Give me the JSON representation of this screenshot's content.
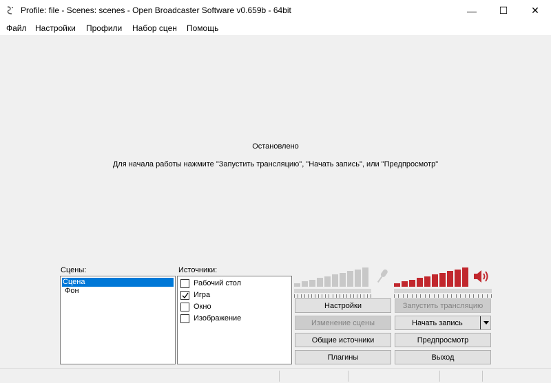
{
  "window": {
    "title": "Profile: file - Scenes: scenes - Open Broadcaster Software v0.659b - 64bit",
    "minimize_glyph": "—",
    "maximize_glyph": "☐",
    "close_glyph": "✕"
  },
  "menu": {
    "items": [
      "Файл",
      "Настройки",
      "Профили",
      "Набор сцен",
      "Помощь"
    ]
  },
  "preview": {
    "status": "Остановлено",
    "hint": "Для начала работы нажмите \"Запустить трансляцию\", \"Начать запись\", или \"Предпросмотр\""
  },
  "scenes": {
    "label": "Сцены:",
    "items": [
      {
        "label": "Сцена",
        "selected": true
      },
      {
        "label": "Фон",
        "selected": false
      }
    ]
  },
  "sources": {
    "label": "Источники:",
    "items": [
      {
        "label": "Рабочий стол",
        "checked": false
      },
      {
        "label": "Игра",
        "checked": true
      },
      {
        "label": "Окно",
        "checked": false
      },
      {
        "label": "Изображение",
        "checked": false
      }
    ]
  },
  "audio": {
    "mic": {
      "icon": "microphone-icon",
      "muted": true,
      "level": 0,
      "color": "#c8c8c8"
    },
    "desktop": {
      "icon": "speaker-icon",
      "muted": false,
      "level": 1.0,
      "color": "#c1272d"
    }
  },
  "buttons": {
    "settings": "Настройки",
    "start_stream": "Запустить трансляцию",
    "edit_scene": "Изменение сцены",
    "start_record": "Начать запись",
    "global_sources": "Общие источники",
    "preview": "Предпросмотр",
    "plugins": "Плагины",
    "exit": "Выход"
  },
  "colors": {
    "accent": "#0078d7",
    "volume_active": "#c1272d",
    "volume_inactive": "#c8c8c8"
  }
}
